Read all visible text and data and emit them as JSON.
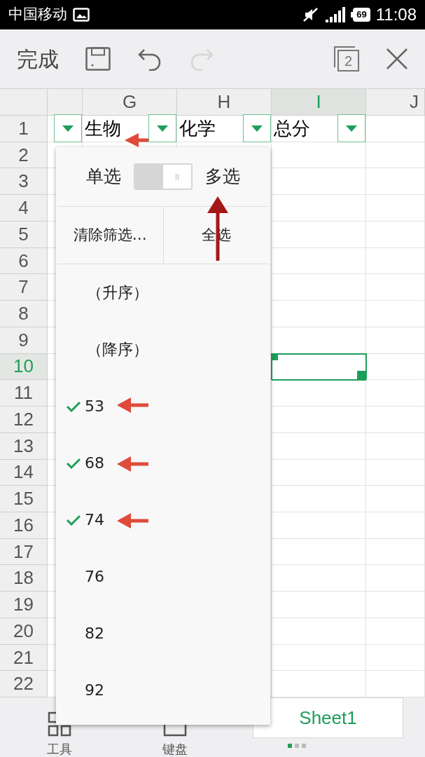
{
  "status_bar": {
    "carrier": "中国移动",
    "battery": "69",
    "time": "11:08"
  },
  "toolbar": {
    "done": "完成",
    "undo_enabled": true,
    "redo_enabled": false,
    "tab_count": "2"
  },
  "columns": [
    {
      "label": "G",
      "selected": false
    },
    {
      "label": "H",
      "selected": false
    },
    {
      "label": "I",
      "selected": true
    },
    {
      "label": "J",
      "selected": false
    }
  ],
  "rows": [
    {
      "label": "1",
      "selected": false
    },
    {
      "label": "2",
      "selected": false
    },
    {
      "label": "3",
      "selected": false
    },
    {
      "label": "4",
      "selected": false
    },
    {
      "label": "5",
      "selected": false
    },
    {
      "label": "6",
      "selected": false
    },
    {
      "label": "7",
      "selected": false
    },
    {
      "label": "8",
      "selected": false
    },
    {
      "label": "9",
      "selected": false
    },
    {
      "label": "10",
      "selected": true
    },
    {
      "label": "11",
      "selected": false
    },
    {
      "label": "12",
      "selected": false
    },
    {
      "label": "13",
      "selected": false
    },
    {
      "label": "14",
      "selected": false
    },
    {
      "label": "15",
      "selected": false
    },
    {
      "label": "16",
      "selected": false
    },
    {
      "label": "17",
      "selected": false
    },
    {
      "label": "18",
      "selected": false
    },
    {
      "label": "19",
      "selected": false
    },
    {
      "label": "20",
      "selected": false
    },
    {
      "label": "21",
      "selected": false
    },
    {
      "label": "22",
      "selected": false
    }
  ],
  "header_cells": [
    {
      "filter": true
    },
    {
      "text": "生物",
      "filter": true
    },
    {
      "text": "化学",
      "filter": true
    },
    {
      "text": "总分",
      "filter": true
    }
  ],
  "filter_popup": {
    "single_label": "单选",
    "multi_label": "多选",
    "multi_on": true,
    "actions": [
      "清除筛选…",
      "全选"
    ],
    "items": [
      {
        "kind": "sort",
        "label": "（升序）"
      },
      {
        "kind": "sort",
        "label": "（降序）"
      },
      {
        "kind": "value",
        "label": "53",
        "checked": true
      },
      {
        "kind": "value",
        "label": "68",
        "checked": true
      },
      {
        "kind": "value",
        "label": "74",
        "checked": true
      },
      {
        "kind": "value",
        "label": "76",
        "checked": false
      },
      {
        "kind": "value",
        "label": "82",
        "checked": false
      },
      {
        "kind": "value",
        "label": "92",
        "checked": false
      }
    ]
  },
  "bottom_bar": {
    "tools": "工具",
    "keyboard": "键盘",
    "sheets": [
      {
        "label": "Sheet1",
        "selected": true
      }
    ]
  }
}
